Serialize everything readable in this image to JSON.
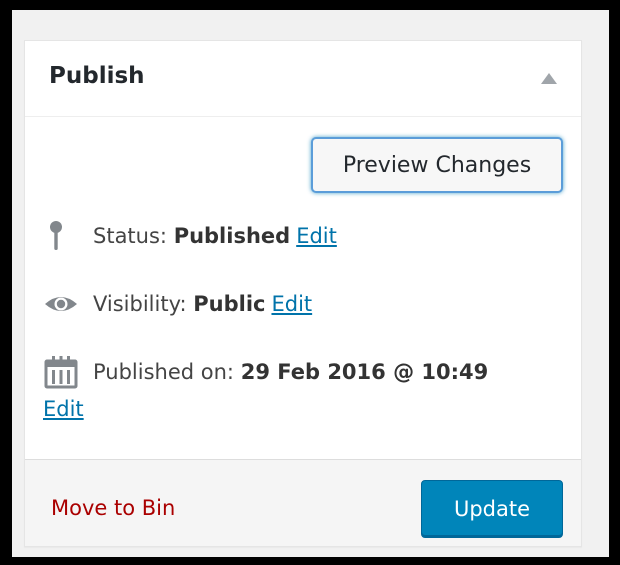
{
  "publish_box": {
    "title": "Publish",
    "preview_label": "Preview Changes",
    "status": {
      "label": "Status:",
      "value": "Published",
      "edit": "Edit"
    },
    "visibility": {
      "label": "Visibility:",
      "value": "Public",
      "edit": "Edit"
    },
    "published_on": {
      "label": "Published on:",
      "value": "29 Feb 2016 @ 10:49",
      "edit": "Edit"
    },
    "move_to_bin": "Move to Bin",
    "update_label": "Update"
  },
  "colors": {
    "link": "#0073aa",
    "delete": "#a00",
    "primary_button": "#0085ba",
    "icon": "#82878c"
  },
  "icons": {
    "status": "pin-icon",
    "visibility": "eye-icon",
    "published_on": "calendar-icon",
    "toggle": "collapse-arrow-icon"
  }
}
